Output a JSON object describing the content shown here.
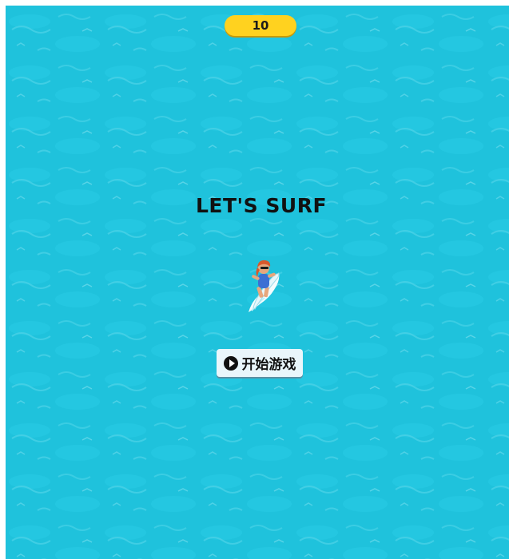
{
  "game": {
    "score": "10",
    "title": "LET'S SURF",
    "start_button_label": "开始游戏"
  },
  "icons": {
    "start": "play-circle-icon",
    "player": "surfer-icon"
  },
  "colors": {
    "water": "#1fc2dc",
    "score_pill": "#ffd21f",
    "button_bg": "#e9f6fb",
    "text": "#111111"
  }
}
